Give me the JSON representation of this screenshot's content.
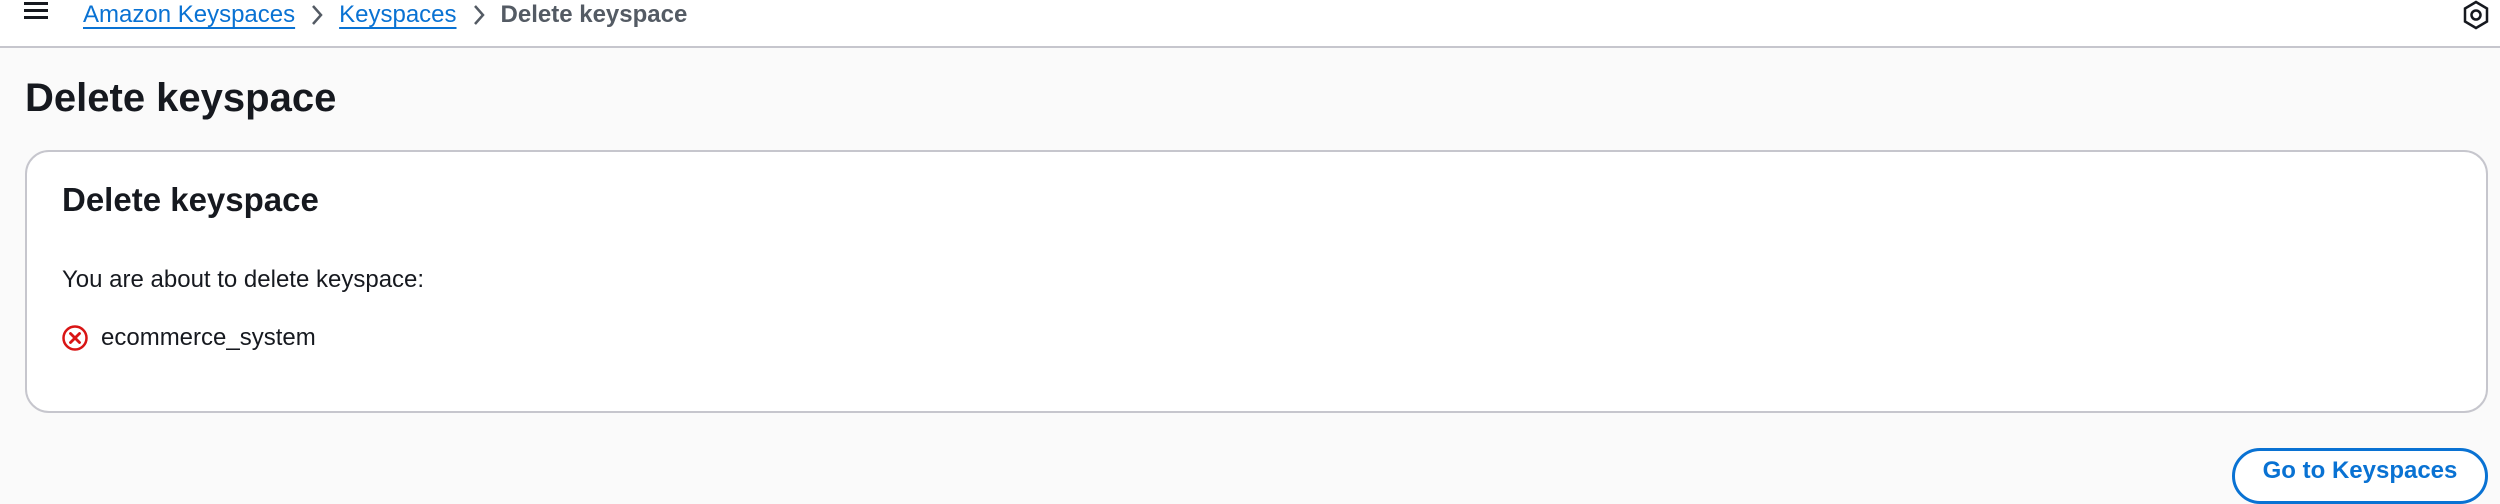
{
  "breadcrumb": {
    "items": [
      "Amazon Keyspaces",
      "Keyspaces"
    ],
    "current": "Delete keyspace"
  },
  "page": {
    "title": "Delete keyspace"
  },
  "card": {
    "title": "Delete keyspace",
    "message": "You are about to delete keyspace:",
    "keyspace_name": "ecommerce_system"
  },
  "actions": {
    "go_to_keyspaces_label": "Go to Keyspaces"
  },
  "icons": {
    "menu": "hamburger-menu-icon",
    "breadcrumb_separator": "chevron-right-icon",
    "settings": "settings-hexagon-icon",
    "keyspace_status": "error-x-circle-icon"
  },
  "colors": {
    "link": "#0972d3",
    "error": "#d91515",
    "border": "#c6c6cd",
    "text": "#16191f",
    "background": "#fafafa"
  }
}
